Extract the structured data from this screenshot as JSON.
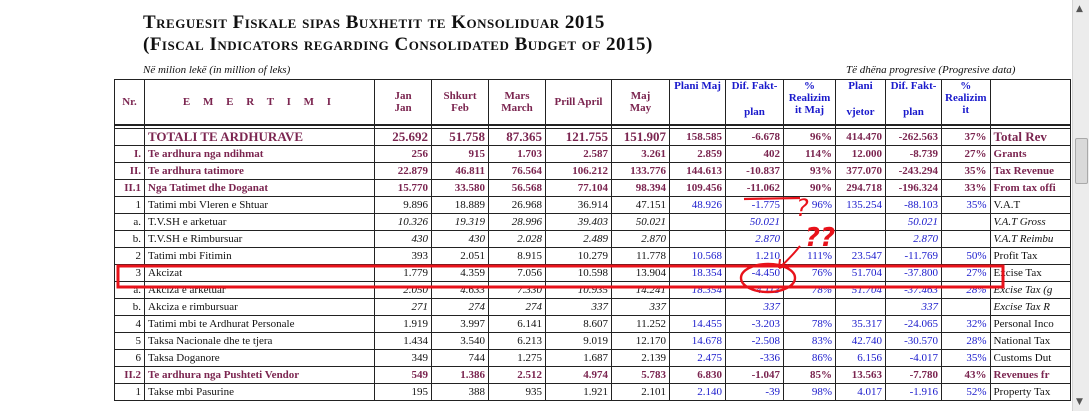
{
  "title_line1": "Treguesit Fiskale sipas Buxhetit te Konsoliduar 2015",
  "title_line2": "(Fiscal Indicators regarding Consolidated Budget of 2015)",
  "unit_left": "Në milion lekë (in million of leks)",
  "unit_right": "Të dhëna progresive (Progresive data)",
  "header": {
    "nr": "Nr.",
    "emertimi": "E M E R T I M I",
    "jan": [
      "Jan",
      "Jan"
    ],
    "shkurt": [
      "Shkurt",
      "Feb"
    ],
    "mars": [
      "Mars",
      "March"
    ],
    "prill": "Prill April",
    "maj": [
      "Maj",
      "May"
    ],
    "plani_maj": "Plani Maj",
    "dif1": [
      "Dif. Fakt-",
      "plan"
    ],
    "realizim1": [
      "%",
      "Realizim",
      "it Maj"
    ],
    "plani_vjetor": [
      "Plani",
      "vjetor"
    ],
    "dif2": [
      "Dif. Fakt-",
      "plan"
    ],
    "realizim2": [
      "%",
      "Realizim",
      "it"
    ]
  },
  "rows": [
    {
      "nr": "",
      "name": "TOTALI TE ARDHURAVE",
      "v": [
        "25.692",
        "51.758",
        "87.365",
        "121.755",
        "151.907",
        "158.585",
        "-6.678",
        "96%",
        "414.470",
        "-262.563",
        "37%"
      ],
      "en": "Total Rev",
      "style": "total"
    },
    {
      "nr": "I.",
      "name": "Te ardhura nga ndihmat",
      "v": [
        "256",
        "915",
        "1.703",
        "2.587",
        "3.261",
        "2.859",
        "402",
        "114%",
        "12.000",
        "-8.739",
        "27%"
      ],
      "en": "Grants",
      "style": "main"
    },
    {
      "nr": "II.",
      "name": "Te ardhura tatimore",
      "v": [
        "22.879",
        "46.811",
        "76.564",
        "106.212",
        "133.776",
        "144.613",
        "-10.837",
        "93%",
        "377.070",
        "-243.294",
        "35%"
      ],
      "en": "Tax Revenue",
      "style": "main"
    },
    {
      "nr": "II.1",
      "name": "Nga Tatimet dhe Doganat",
      "v": [
        "15.770",
        "33.580",
        "56.568",
        "77.104",
        "98.394",
        "109.456",
        "-11.062",
        "90%",
        "294.718",
        "-196.324",
        "33%"
      ],
      "en": "From tax offi",
      "style": "main"
    },
    {
      "nr": "1",
      "name": "Tatimi mbi Vleren e Shtuar",
      "v": [
        "9.896",
        "18.889",
        "26.968",
        "36.914",
        "47.151",
        "48.926",
        "-1.775",
        "96%",
        "135.254",
        "-88.103",
        "35%"
      ],
      "en": "V.A.T",
      "style": "plain"
    },
    {
      "nr": "a.",
      "name": "T.V.SH e arketuar",
      "v": [
        "10.326",
        "19.319",
        "28.996",
        "39.403",
        "50.021",
        "",
        "50.021",
        "",
        "",
        "50.021",
        ""
      ],
      "en": "V.A.T Gross",
      "style": "sub"
    },
    {
      "nr": "b.",
      "name": "T.V.SH e Rimbursuar",
      "v": [
        "430",
        "430",
        "2.028",
        "2.489",
        "2.870",
        "",
        "2.870",
        "",
        "",
        "2.870",
        ""
      ],
      "en": "V.A.T Reimbu",
      "style": "sub"
    },
    {
      "nr": "2",
      "name": "Tatimi mbi Fitimin",
      "v": [
        "393",
        "2.051",
        "8.915",
        "10.279",
        "11.778",
        "10.568",
        "1.210",
        "111%",
        "23.547",
        "-11.769",
        "50%"
      ],
      "en": "Profit Tax",
      "style": "plain"
    },
    {
      "nr": "3",
      "name": "Akcizat",
      "v": [
        "1.779",
        "4.359",
        "7.056",
        "10.598",
        "13.904",
        "18.354",
        "-4.450",
        "76%",
        "51.704",
        "-37.800",
        "27%"
      ],
      "en": "Excise Tax",
      "style": "plain"
    },
    {
      "nr": "a.",
      "name": "Akciza e arketuar",
      "v": [
        "2.050",
        "4.633",
        "7.330",
        "10.935",
        "14.241",
        "18.354",
        "-4.113",
        "78%",
        "51.704",
        "-37.463",
        "28%"
      ],
      "en": "Excise Tax (g",
      "style": "sub"
    },
    {
      "nr": "b.",
      "name": "Akciza e rimbursuar",
      "v": [
        "271",
        "274",
        "274",
        "337",
        "337",
        "",
        "337",
        "",
        "",
        "337",
        ""
      ],
      "en": "Excise Tax R",
      "style": "sub"
    },
    {
      "nr": "4",
      "name": "Tatimi mbi te Ardhurat Personale",
      "v": [
        "1.919",
        "3.997",
        "6.141",
        "8.607",
        "11.252",
        "14.455",
        "-3.203",
        "78%",
        "35.317",
        "-24.065",
        "32%"
      ],
      "en": "Personal Inco",
      "style": "plain"
    },
    {
      "nr": "5",
      "name": "Taksa Nacionale dhe te tjera",
      "v": [
        "1.434",
        "3.540",
        "6.213",
        "9.019",
        "12.170",
        "14.678",
        "-2.508",
        "83%",
        "42.740",
        "-30.570",
        "28%"
      ],
      "en": "National Tax",
      "style": "plain"
    },
    {
      "nr": "6",
      "name": "Taksa Doganore",
      "v": [
        "349",
        "744",
        "1.275",
        "1.687",
        "2.139",
        "2.475",
        "-336",
        "86%",
        "6.156",
        "-4.017",
        "35%"
      ],
      "en": "Customs Dut",
      "style": "plain"
    },
    {
      "nr": "II.2",
      "name": "Te ardhura nga Pushteti Vendor",
      "v": [
        "549",
        "1.386",
        "2.512",
        "4.974",
        "5.783",
        "6.830",
        "-1.047",
        "85%",
        "13.563",
        "-7.780",
        "43%"
      ],
      "en": "Revenues fr",
      "style": "main"
    },
    {
      "nr": "1",
      "name": "Takse mbi Pasurine",
      "v": [
        "195",
        "388",
        "935",
        "1.921",
        "2.101",
        "2.140",
        "-39",
        "98%",
        "4.017",
        "-1.916",
        "52%"
      ],
      "en": "Property Tax",
      "style": "plain"
    }
  ],
  "annotation": {
    "marks": [
      "?",
      "??"
    ],
    "color": "#e8121a"
  },
  "colors": {
    "maroon": "#7b2550",
    "blue": "#1a1acc",
    "annotation_red": "#e8121a"
  }
}
